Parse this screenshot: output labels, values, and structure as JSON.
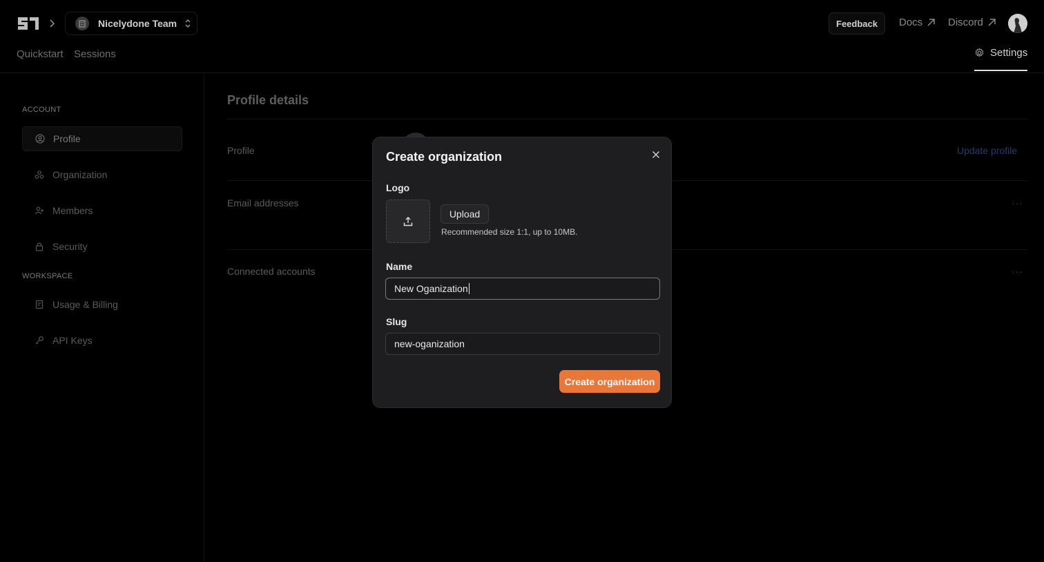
{
  "header": {
    "team_name": "Nicelydone Team",
    "feedback_label": "Feedback",
    "docs_label": "Docs",
    "discord_label": "Discord"
  },
  "nav": {
    "tabs": [
      {
        "label": "Quickstart"
      },
      {
        "label": "Sessions"
      }
    ],
    "settings_label": "Settings"
  },
  "sidebar": {
    "account_heading": "ACCOUNT",
    "workspace_heading": "WORKSPACE",
    "items": [
      {
        "label": "Profile",
        "icon": "user-circle-icon"
      },
      {
        "label": "Organization",
        "icon": "organization-icon"
      },
      {
        "label": "Members",
        "icon": "user-plus-icon"
      },
      {
        "label": "Security",
        "icon": "lock-icon"
      },
      {
        "label": "Usage & Billing",
        "icon": "receipt-icon"
      },
      {
        "label": "API Keys",
        "icon": "key-icon"
      }
    ]
  },
  "main": {
    "title": "Profile details",
    "rows": [
      {
        "label": "Profile"
      },
      {
        "label": "Email addresses"
      },
      {
        "label": "Connected accounts"
      }
    ],
    "update_profile_label": "Update profile"
  },
  "modal": {
    "title": "Create organization",
    "logo_label": "Logo",
    "upload_label": "Upload",
    "upload_hint": "Recommended size 1:1, up to 10MB.",
    "name_label": "Name",
    "name_value": "New Oganization",
    "slug_label": "Slug",
    "slug_value": "new-oganization",
    "submit_label": "Create organization"
  },
  "colors": {
    "accent": "#e8773a",
    "modal_bg": "#1e1e20",
    "page_bg": "#000000"
  }
}
